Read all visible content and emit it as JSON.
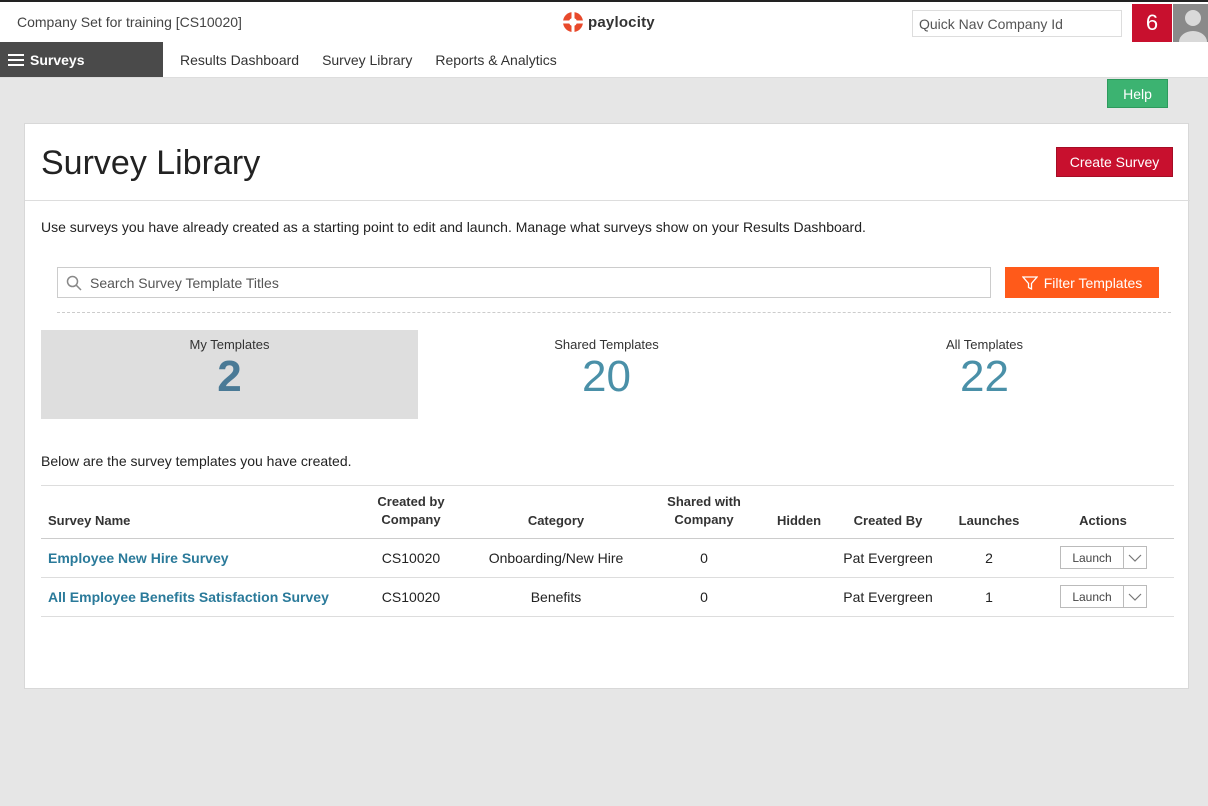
{
  "header": {
    "company": "Company Set for training [CS10020]",
    "brand": "paylocity",
    "quicknav_placeholder": "Quick Nav Company Id",
    "notification_count": "6"
  },
  "nav": {
    "module": "Surveys",
    "links": [
      "Results Dashboard",
      "Survey Library",
      "Reports & Analytics"
    ]
  },
  "help_label": "Help",
  "page": {
    "title": "Survey Library",
    "create_label": "Create Survey",
    "intro": "Use surveys you have already created as a starting point to edit and launch. Manage what surveys show on your Results Dashboard.",
    "search_placeholder": "Search Survey Template Titles",
    "filter_label": "Filter Templates",
    "below_text": "Below are the survey templates you have created."
  },
  "stats": [
    {
      "label": "My Templates",
      "count": "2"
    },
    {
      "label": "Shared Templates",
      "count": "20"
    },
    {
      "label": "All Templates",
      "count": "22"
    }
  ],
  "table": {
    "headers": {
      "name": "Survey Name",
      "created_by_company_1": "Created by",
      "created_by_company_2": "Company",
      "category": "Category",
      "shared_1": "Shared with",
      "shared_2": "Company",
      "hidden": "Hidden",
      "created_by": "Created By",
      "launches": "Launches",
      "actions": "Actions"
    },
    "rows": [
      {
        "name": "Employee New Hire Survey",
        "company": "CS10020",
        "category": "Onboarding/New Hire",
        "shared": "0",
        "hidden": "",
        "created_by": "Pat Evergreen",
        "launches": "2",
        "action": "Launch"
      },
      {
        "name": "All Employee Benefits Satisfaction Survey",
        "company": "CS10020",
        "category": "Benefits",
        "shared": "0",
        "hidden": "",
        "created_by": "Pat Evergreen",
        "launches": "1",
        "action": "Launch"
      }
    ]
  },
  "colors": {
    "brand_red": "#c8102e",
    "filter_orange": "#ff5a1a",
    "help_green": "#3cb371",
    "link_teal": "#2a7a9a",
    "count_blue": "#4a90a8"
  }
}
